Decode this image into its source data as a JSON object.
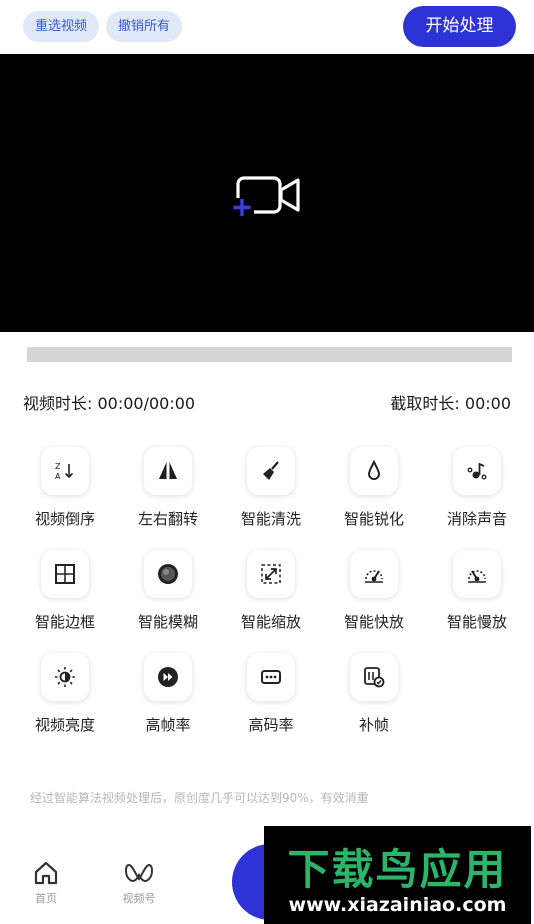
{
  "header": {
    "reselect_label": "重选视频",
    "undo_label": "撤销所有",
    "start_label": "开始处理"
  },
  "preview": {
    "icon": "add-video-icon"
  },
  "durations": {
    "video": "视频时长: 00:00/00:00",
    "clip": "截取时长: 00:00"
  },
  "tools": [
    {
      "label": "视频倒序",
      "icon": "reverse-sort-icon"
    },
    {
      "label": "左右翻转",
      "icon": "flip-horizontal-icon"
    },
    {
      "label": "智能清洗",
      "icon": "broom-icon"
    },
    {
      "label": "智能锐化",
      "icon": "droplet-icon"
    },
    {
      "label": "消除声音",
      "icon": "mute-music-icon"
    },
    {
      "label": "智能边框",
      "icon": "border-grid-icon"
    },
    {
      "label": "智能模糊",
      "icon": "blur-circle-icon"
    },
    {
      "label": "智能缩放",
      "icon": "zoom-expand-icon"
    },
    {
      "label": "智能快放",
      "icon": "speedometer-fast-icon"
    },
    {
      "label": "智能慢放",
      "icon": "speedometer-slow-icon"
    },
    {
      "label": "视频亮度",
      "icon": "brightness-icon"
    },
    {
      "label": "高帧率",
      "icon": "fast-forward-icon"
    },
    {
      "label": "高码率",
      "icon": "bitrate-icon"
    },
    {
      "label": "补帧",
      "icon": "frame-fill-icon"
    }
  ],
  "note": "经过智能算法视频处理后，原创度几乎可以达到90%，有效消重",
  "nav": {
    "home_label": "首页",
    "video_label": "视频号"
  },
  "watermark": {
    "title": "下载鸟应用",
    "url": "www.xiazainiao.com"
  },
  "colors": {
    "accent": "#2f33d6",
    "pill_bg": "#dfe9f8",
    "pill_text": "#3a57d4",
    "watermark_green": "#2bb46a"
  }
}
